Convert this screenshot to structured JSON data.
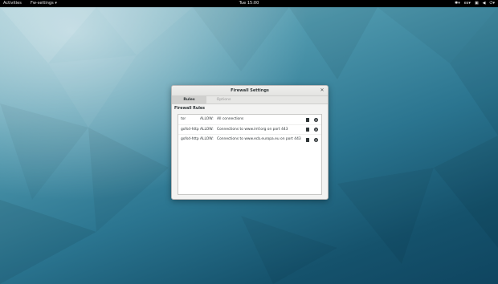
{
  "topbar": {
    "activities": "Activities",
    "app_menu": "Fw-settings",
    "clock": "Tue 15:00",
    "keyboard_layout": "es"
  },
  "dialog": {
    "title": "Firewall Settings",
    "tabs": [
      {
        "label": "Rules",
        "active": true
      },
      {
        "label": "Options",
        "active": false
      }
    ],
    "section_title": "Firewall Rules",
    "rules": [
      {
        "app": "tor",
        "action": "ALLOW:",
        "target": "All connections"
      },
      {
        "app": "gofsd-http",
        "action": "ALLOW:",
        "target": "Connections to www.imf.org on port 443"
      },
      {
        "app": "gofsd-http",
        "action": "ALLOW:",
        "target": "Connections to www.ecb.europa.eu on port 443"
      }
    ]
  },
  "colors": {
    "topbar": "#000000",
    "wallpaper_dark": "#15526c",
    "wallpaper_light": "#8fc0cc"
  }
}
